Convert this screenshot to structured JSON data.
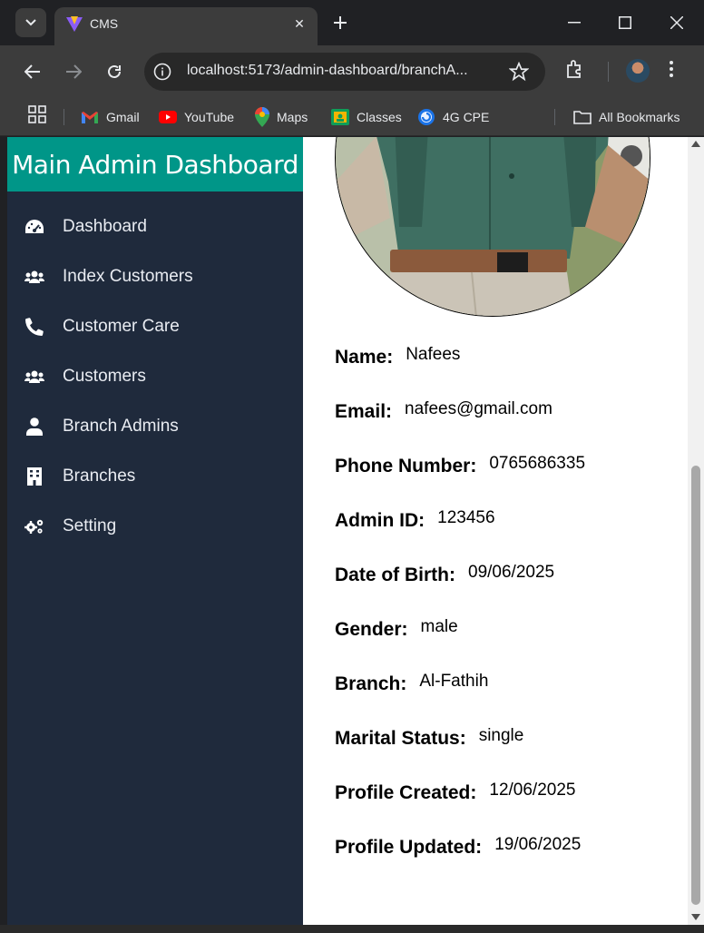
{
  "browser": {
    "tab_title": "CMS",
    "url": "localhost:5173/admin-dashboard/branchA...",
    "bookmarks": [
      {
        "label": "Gmail",
        "icon": "gmail-icon"
      },
      {
        "label": "YouTube",
        "icon": "youtube-icon"
      },
      {
        "label": "Maps",
        "icon": "maps-icon"
      },
      {
        "label": "Classes",
        "icon": "classroom-icon"
      },
      {
        "label": "4G CPE",
        "icon": "globe-icon"
      }
    ],
    "all_bookmarks": "All Bookmarks"
  },
  "sidebar": {
    "brand": "Main Admin Dashboard",
    "brand_color": "#009688",
    "background": "#1f2a3c",
    "items": [
      {
        "label": "Dashboard",
        "icon": "speedometer-icon"
      },
      {
        "label": "Index Customers",
        "icon": "users-icon"
      },
      {
        "label": "Customer Care",
        "icon": "phone-icon"
      },
      {
        "label": "Customers",
        "icon": "users-icon"
      },
      {
        "label": "Branch Admins",
        "icon": "user-icon"
      },
      {
        "label": "Branches",
        "icon": "building-icon"
      },
      {
        "label": "Setting",
        "icon": "gears-icon"
      }
    ]
  },
  "profile": {
    "fields": [
      {
        "label": "Name:",
        "value": "Nafees"
      },
      {
        "label": "Email:",
        "value": "nafees@gmail.com"
      },
      {
        "label": "Phone Number:",
        "value": "0765686335"
      },
      {
        "label": "Admin ID:",
        "value": "123456"
      },
      {
        "label": "Date of Birth:",
        "value": "09/06/2025"
      },
      {
        "label": "Gender:",
        "value": "male"
      },
      {
        "label": "Branch:",
        "value": "Al-Fathih"
      },
      {
        "label": "Marital Status:",
        "value": "single"
      },
      {
        "label": "Profile Created:",
        "value": "12/06/2025"
      },
      {
        "label": "Profile Updated:",
        "value": "19/06/2025"
      }
    ]
  }
}
